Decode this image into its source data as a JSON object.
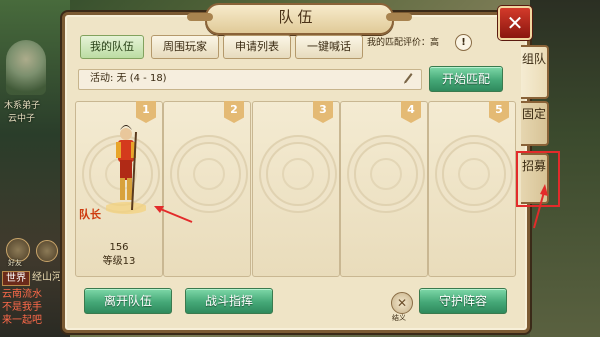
{
  "window": {
    "title": "队伍"
  },
  "tabs": [
    {
      "label": "我的队伍",
      "active": true
    },
    {
      "label": "周围玩家",
      "active": false
    },
    {
      "label": "申请列表",
      "active": false
    },
    {
      "label": "一键喊话",
      "active": false
    }
  ],
  "match_eval": {
    "label": "我的匹配评价：高"
  },
  "activity": {
    "text": "活动: 无 (4 - 18)"
  },
  "buttons": {
    "start_match": "开始匹配",
    "leave_team": "离开队伍",
    "battle_command": "战斗指挥",
    "guard_formation": "守护阵容"
  },
  "slots": [
    {
      "number": "1",
      "leader_label": "队长",
      "member_id": "156",
      "level": "等级13"
    },
    {
      "number": "2"
    },
    {
      "number": "3"
    },
    {
      "number": "4"
    },
    {
      "number": "5"
    }
  ],
  "side_tabs": [
    {
      "label": "组队",
      "active": true
    },
    {
      "label": "固定",
      "active": false
    },
    {
      "label": "招募",
      "active": false
    }
  ],
  "knot_label": "结义",
  "background": {
    "left_name_1": "木系弟子",
    "left_name_2": "云中子",
    "chat_tab_world": "世界",
    "chat_channel": "经山河",
    "chat_lines": [
      "云南流水",
      "不是我手",
      "来一起吧"
    ],
    "friend_icon_label": "好友"
  },
  "colors": {
    "highlight": "#e32b2b",
    "green_button": "#45a877",
    "leader_text": "#ce3a0e"
  }
}
